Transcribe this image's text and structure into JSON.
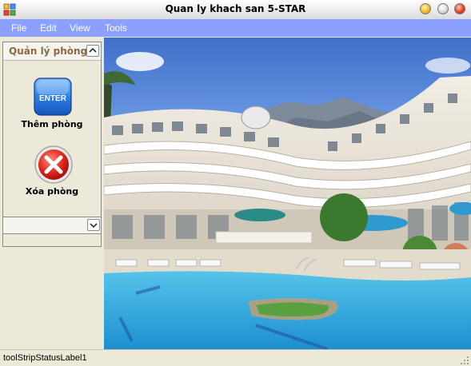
{
  "window": {
    "title": "Quan ly khach san 5-STAR"
  },
  "menu": [
    {
      "label": "File"
    },
    {
      "label": "Edit"
    },
    {
      "label": "View"
    },
    {
      "label": "Tools"
    }
  ],
  "room_panel": {
    "title": "Quản lý phòng",
    "actions": [
      {
        "label": "Thêm phòng",
        "icon": "enter-key-icon",
        "icon_text": "ENTER"
      },
      {
        "label": "Xóa phòng",
        "icon": "delete-x-icon"
      }
    ]
  },
  "status": {
    "label": "toolStripStatusLabel1"
  },
  "colors": {
    "menubar": "#8ca0ff",
    "panel_bg": "#ece9d8",
    "group_title": "#8a6a45"
  }
}
